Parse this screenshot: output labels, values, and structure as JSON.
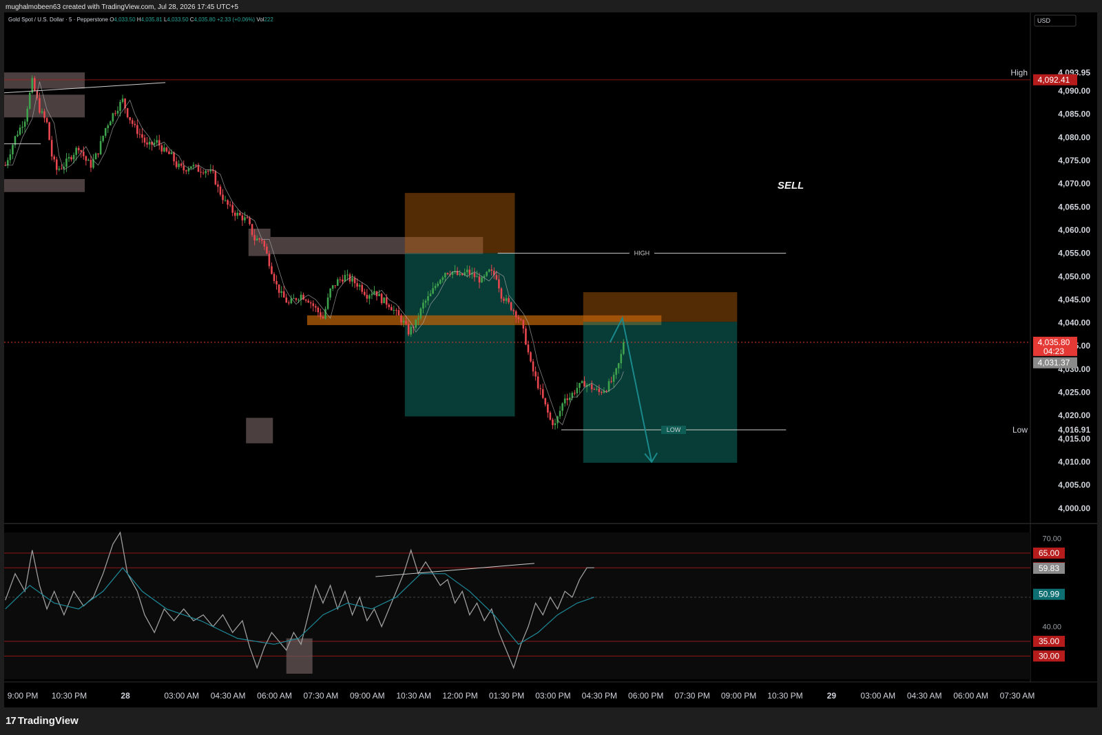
{
  "header": {
    "credit": "mughalmobeen63 created with TradingView.com, Jul 28, 2026 17:45 UTC+5"
  },
  "legend": {
    "symbol": "Gold Spot / U.S. Dollar · 5 · Pepperstone",
    "o_label": "O",
    "o_value": "4,033.50",
    "h_label": "H",
    "h_value": "4,035.81",
    "l_label": "L",
    "l_value": "4,033.50",
    "c_label": "C",
    "c_value": "4,035.80",
    "change": "+2.33 (+0.06%)",
    "vol_label": "Vol",
    "vol_value": "222",
    "value_color": "#26a69a"
  },
  "footer": {
    "brand": "TradingView"
  },
  "colors": {
    "up": "#26a69a",
    "down": "#ef5350",
    "up_candle": "#3fa34d",
    "down_candle": "#e8474f",
    "rsi_line": "#9e9e9e",
    "rsi_ma": "#1e8a9a",
    "zone_grey": "#6b5a5a",
    "zone_orange": "#b8600a",
    "zone_teal": "#0f6e63",
    "price_red": "#e53935",
    "level_red": "#b71c1c"
  },
  "chart_data": [
    {
      "type": "candlestick",
      "title": "Gold Spot / U.S. Dollar · 5 · Pepperstone",
      "currency": "USD",
      "ylim": [
        3997,
        4101
      ],
      "y_ticks": [
        "4,000.00",
        "4,005.00",
        "4,010.00",
        "4,015.00",
        "4,020.00",
        "4,025.00",
        "4,030.00",
        "4,035.00",
        "4,040.00",
        "4,045.00",
        "4,050.00",
        "4,055.00",
        "4,060.00",
        "4,065.00",
        "4,070.00",
        "4,075.00",
        "4,080.00",
        "4,085.00",
        "4,090.00"
      ],
      "y_tick_values": [
        4000,
        4005,
        4010,
        4015,
        4020,
        4025,
        4030,
        4035,
        4040,
        4045,
        4050,
        4055,
        4060,
        4065,
        4070,
        4075,
        4080,
        4085,
        4090
      ],
      "x_ticks": [
        "9:00 PM",
        "10:30 PM",
        "28",
        "03:00 AM",
        "04:30 AM",
        "06:00 AM",
        "07:30 AM",
        "09:00 AM",
        "10:30 AM",
        "12:00 PM",
        "01:30 PM",
        "03:00 PM",
        "04:30 PM",
        "06:00 PM",
        "07:30 PM",
        "09:00 PM",
        "10:30 PM",
        "29",
        "03:00 AM",
        "04:30 AM",
        "06:00 AM",
        "07:30 AM"
      ],
      "x_tick_slots": [
        2,
        21,
        44,
        67,
        86,
        105,
        124,
        143,
        162,
        181,
        200,
        219,
        238,
        257,
        276,
        295,
        314,
        333,
        352,
        371,
        390,
        409
      ],
      "n_slots": 420,
      "price_path": [
        [
          0,
          4074
        ],
        [
          4,
          4080
        ],
        [
          8,
          4084
        ],
        [
          11,
          4092
        ],
        [
          14,
          4086
        ],
        [
          17,
          4083
        ],
        [
          19,
          4076
        ],
        [
          21,
          4073
        ],
        [
          24,
          4074
        ],
        [
          27,
          4076
        ],
        [
          30,
          4078
        ],
        [
          33,
          4075
        ],
        [
          35,
          4074
        ],
        [
          38,
          4077
        ],
        [
          41,
          4082
        ],
        [
          44,
          4085
        ],
        [
          48,
          4088
        ],
        [
          50,
          4085
        ],
        [
          53,
          4082
        ],
        [
          56,
          4080
        ],
        [
          58,
          4078
        ],
        [
          62,
          4079
        ],
        [
          65,
          4077
        ],
        [
          68,
          4076
        ],
        [
          70,
          4074
        ],
        [
          73,
          4073
        ],
        [
          76,
          4074
        ],
        [
          79,
          4073
        ],
        [
          82,
          4073
        ],
        [
          85,
          4072
        ],
        [
          87,
          4069
        ],
        [
          90,
          4066
        ],
        [
          93,
          4064
        ],
        [
          96,
          4063
        ],
        [
          99,
          4062
        ],
        [
          102,
          4058
        ],
        [
          105,
          4058
        ],
        [
          108,
          4053
        ],
        [
          111,
          4048
        ],
        [
          113,
          4046
        ],
        [
          116,
          4044
        ],
        [
          118,
          4045
        ],
        [
          121,
          4046
        ],
        [
          124,
          4045
        ],
        [
          127,
          4043
        ],
        [
          130,
          4041
        ],
        [
          133,
          4047
        ],
        [
          136,
          4049
        ],
        [
          139,
          4050
        ],
        [
          142,
          4049
        ],
        [
          145,
          4048
        ],
        [
          148,
          4046
        ],
        [
          151,
          4047
        ],
        [
          154,
          4045
        ],
        [
          157,
          4044
        ],
        [
          160,
          4042
        ],
        [
          163,
          4040
        ],
        [
          165,
          4038
        ],
        [
          168,
          4040
        ],
        [
          171,
          4044
        ],
        [
          174,
          4046
        ],
        [
          177,
          4049
        ],
        [
          180,
          4051
        ],
        [
          183,
          4051
        ],
        [
          186,
          4050
        ],
        [
          189,
          4051
        ],
        [
          192,
          4050
        ],
        [
          195,
          4049
        ],
        [
          198,
          4051
        ],
        [
          201,
          4050
        ],
        [
          203,
          4046
        ],
        [
          206,
          4044
        ],
        [
          209,
          4042
        ],
        [
          211,
          4040
        ],
        [
          213,
          4036
        ],
        [
          215,
          4031
        ],
        [
          217,
          4028
        ],
        [
          219,
          4025
        ],
        [
          221,
          4022
        ],
        [
          223,
          4019
        ],
        [
          225,
          4018
        ],
        [
          227,
          4021
        ],
        [
          229,
          4024
        ],
        [
          231,
          4024
        ],
        [
          234,
          4026
        ],
        [
          237,
          4027
        ],
        [
          240,
          4026
        ],
        [
          243,
          4025
        ],
        [
          246,
          4026
        ],
        [
          249,
          4028
        ],
        [
          251,
          4031
        ],
        [
          252,
          4033
        ],
        [
          253,
          4035.8
        ]
      ],
      "horizontal_levels": [
        4092.41,
        4035.8,
        4031.37
      ],
      "session_high": "4,093.95",
      "session_high_label": "High",
      "session_low": "4,016.91",
      "session_low_label": "Low",
      "price_labels": [
        {
          "text": "4,092.41",
          "value": 4092.41,
          "color": "#b71c1c"
        },
        {
          "text": "4,035.80",
          "value": 4035.8,
          "color": "#e53935",
          "countdown": "04:23"
        },
        {
          "text": "4,031.37",
          "value": 4031.37,
          "color": "#8a8a8a"
        }
      ],
      "annotations": {
        "sell_text": "SELL",
        "high_line": {
          "label": "HIGH",
          "value": 4055.0
        },
        "low_line": {
          "label": "LOW",
          "value": 4016.9
        },
        "zones": [
          {
            "kind": "grey",
            "slot0": 0,
            "slot1": 33,
            "top": 4094,
            "bottom": 4090.5
          },
          {
            "kind": "grey",
            "slot0": 0,
            "slot1": 33,
            "top": 4089.2,
            "bottom": 4084.3
          },
          {
            "kind": "grey",
            "slot0": 0,
            "slot1": 33,
            "top": 4071,
            "bottom": 4068.2
          },
          {
            "kind": "grey",
            "slot0": 100,
            "slot1": 109,
            "top": 4060.3,
            "bottom": 4054.4
          },
          {
            "kind": "grey",
            "slot0": 109,
            "slot1": 196,
            "top": 4058.5,
            "bottom": 4054.8
          },
          {
            "kind": "grey",
            "slot0": 99,
            "slot1": 110,
            "top": 4019.5,
            "bottom": 4014
          },
          {
            "kind": "orange",
            "slot0": 164,
            "slot1": 209,
            "top": 4068,
            "bottom": 4055.0
          },
          {
            "kind": "teal",
            "slot0": 164,
            "slot1": 209,
            "top": 4055.0,
            "bottom": 4019.8
          },
          {
            "kind": "orange-bar",
            "slot0": 124,
            "slot1": 269,
            "top": 4041.6,
            "bottom": 4039.5
          },
          {
            "kind": "orange",
            "slot0": 237,
            "slot1": 300,
            "top": 4046.6,
            "bottom": 4040.2
          },
          {
            "kind": "teal",
            "slot0": 237,
            "slot1": 300,
            "top": 4040.2,
            "bottom": 4009.8
          }
        ],
        "projection": [
          [
            248,
            4035.8
          ],
          [
            253,
            4041
          ],
          [
            265,
            4010
          ]
        ]
      }
    },
    {
      "type": "line",
      "title": "RSI",
      "ylim": [
        24,
        72
      ],
      "y_ticks": [
        "70.00",
        "40.00"
      ],
      "y_tick_values": [
        70,
        40
      ],
      "levels": [
        {
          "text": "65.00",
          "value": 65,
          "color": "#b71c1c"
        },
        {
          "text": "60.00",
          "value": 60,
          "color": "#b71c1c"
        },
        {
          "text": "35.00",
          "value": 35,
          "color": "#b71c1c"
        },
        {
          "text": "30.00",
          "value": 30,
          "color": "#b71c1c"
        }
      ],
      "current_labels": [
        {
          "text": "59.83",
          "value": 59.83,
          "color": "#8a8a8a"
        },
        {
          "text": "50.99",
          "value": 50.99,
          "color": "#0e6f73"
        }
      ],
      "rsi_path": [
        [
          0,
          49
        ],
        [
          4,
          58
        ],
        [
          8,
          52
        ],
        [
          11,
          66
        ],
        [
          14,
          54
        ],
        [
          17,
          46
        ],
        [
          20,
          52
        ],
        [
          24,
          44
        ],
        [
          28,
          52
        ],
        [
          32,
          47
        ],
        [
          36,
          50
        ],
        [
          40,
          58
        ],
        [
          44,
          68
        ],
        [
          47,
          72
        ],
        [
          50,
          58
        ],
        [
          54,
          52
        ],
        [
          57,
          44
        ],
        [
          61,
          38
        ],
        [
          65,
          46
        ],
        [
          69,
          42
        ],
        [
          73,
          46
        ],
        [
          77,
          42
        ],
        [
          81,
          44
        ],
        [
          85,
          40
        ],
        [
          89,
          44
        ],
        [
          93,
          38
        ],
        [
          97,
          42
        ],
        [
          100,
          33
        ],
        [
          103,
          26
        ],
        [
          106,
          33
        ],
        [
          109,
          38
        ],
        [
          112,
          35
        ],
        [
          115,
          32
        ],
        [
          118,
          38
        ],
        [
          121,
          34
        ],
        [
          124,
          44
        ],
        [
          127,
          54
        ],
        [
          130,
          48
        ],
        [
          133,
          54
        ],
        [
          136,
          46
        ],
        [
          139,
          52
        ],
        [
          142,
          44
        ],
        [
          145,
          50
        ],
        [
          148,
          42
        ],
        [
          151,
          46
        ],
        [
          154,
          40
        ],
        [
          157,
          46
        ],
        [
          160,
          52
        ],
        [
          163,
          58
        ],
        [
          166,
          66
        ],
        [
          169,
          58
        ],
        [
          172,
          62
        ],
        [
          175,
          58
        ],
        [
          178,
          54
        ],
        [
          181,
          56
        ],
        [
          184,
          48
        ],
        [
          187,
          52
        ],
        [
          190,
          44
        ],
        [
          193,
          48
        ],
        [
          196,
          42
        ],
        [
          199,
          46
        ],
        [
          202,
          38
        ],
        [
          205,
          32
        ],
        [
          208,
          26
        ],
        [
          211,
          34
        ],
        [
          214,
          40
        ],
        [
          217,
          48
        ],
        [
          220,
          44
        ],
        [
          223,
          50
        ],
        [
          226,
          46
        ],
        [
          229,
          52
        ],
        [
          232,
          50
        ],
        [
          235,
          56
        ],
        [
          238,
          60
        ],
        [
          241,
          60
        ]
      ],
      "rsi_ma_path": [
        [
          0,
          46
        ],
        [
          10,
          54
        ],
        [
          20,
          48
        ],
        [
          30,
          46
        ],
        [
          40,
          52
        ],
        [
          48,
          60
        ],
        [
          56,
          52
        ],
        [
          66,
          46
        ],
        [
          80,
          42
        ],
        [
          95,
          36
        ],
        [
          110,
          34
        ],
        [
          120,
          36
        ],
        [
          130,
          44
        ],
        [
          140,
          48
        ],
        [
          150,
          46
        ],
        [
          160,
          50
        ],
        [
          170,
          58
        ],
        [
          180,
          58
        ],
        [
          190,
          52
        ],
        [
          200,
          44
        ],
        [
          210,
          34
        ],
        [
          218,
          38
        ],
        [
          226,
          44
        ],
        [
          234,
          48
        ],
        [
          241,
          50
        ]
      ]
    }
  ]
}
